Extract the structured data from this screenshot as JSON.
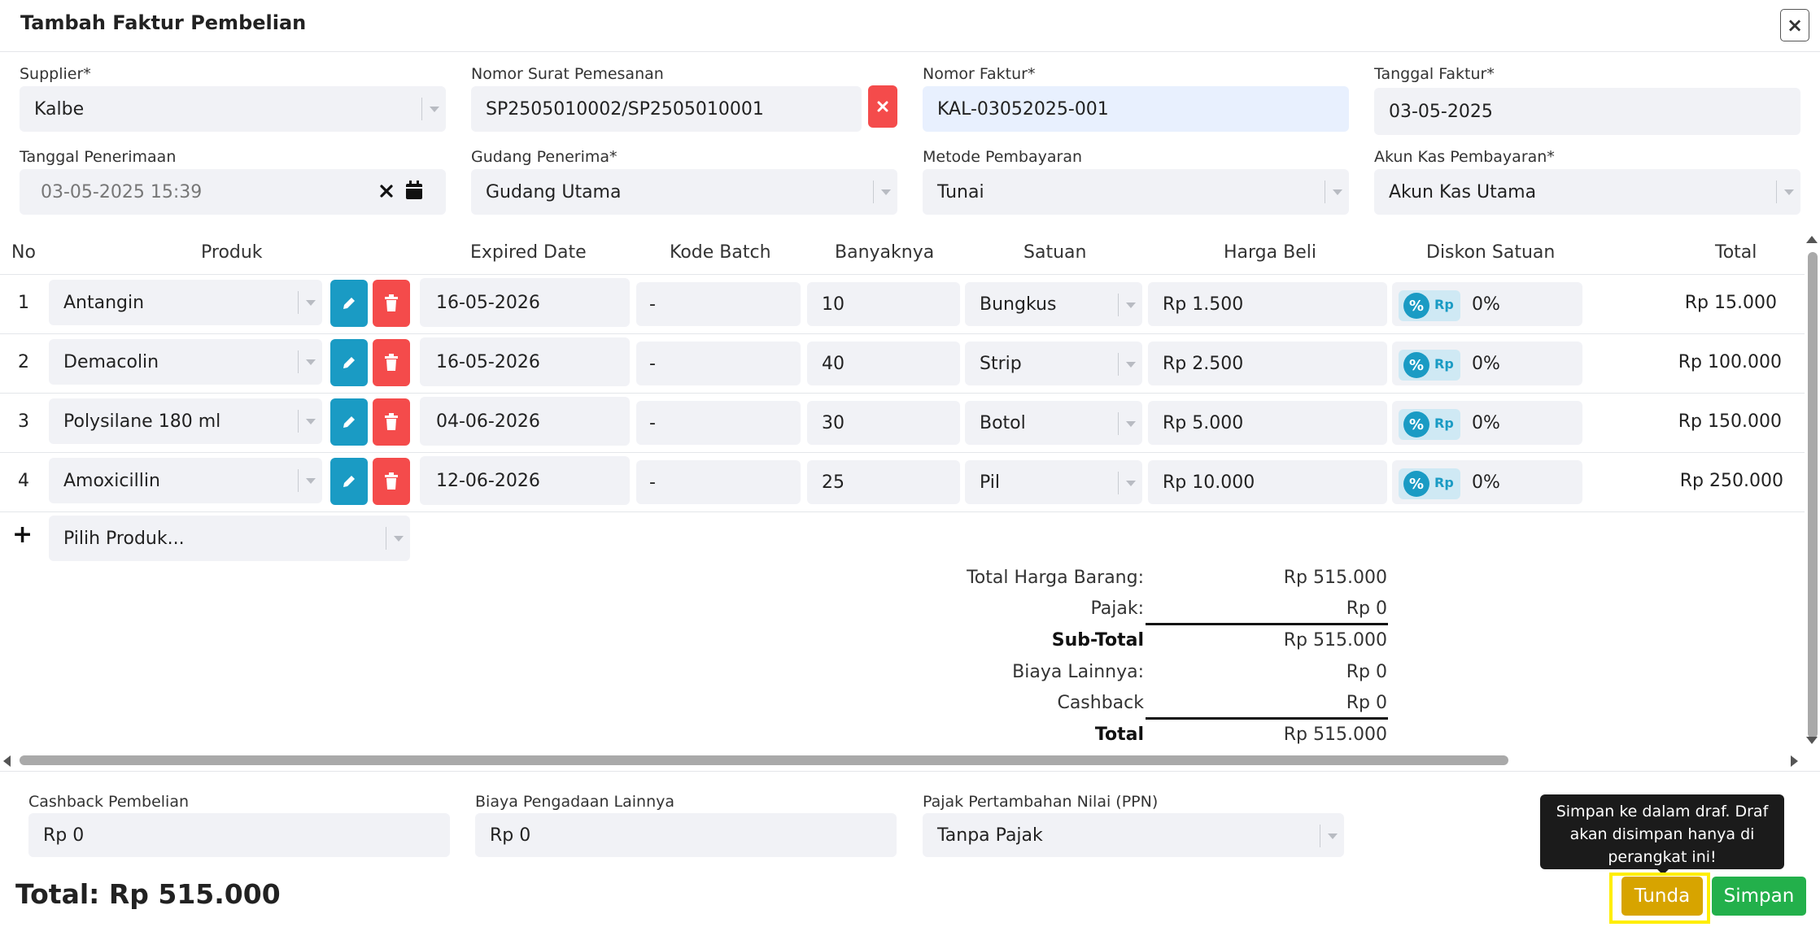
{
  "header": {
    "title": "Tambah Faktur Pembelian",
    "close_label": "×"
  },
  "form": {
    "supplier": {
      "label": "Supplier*",
      "value": "Kalbe"
    },
    "nomor_sp": {
      "label": "Nomor Surat Pemesanan",
      "value": "SP2505010002/SP2505010001"
    },
    "nomor_faktur": {
      "label": "Nomor Faktur*",
      "value": "KAL-03052025-001"
    },
    "tanggal_faktur": {
      "label": "Tanggal Faktur*",
      "value": "03-05-2025"
    },
    "tanggal_penerimaan": {
      "label": "Tanggal Penerimaan",
      "value": "03-05-2025 15:39"
    },
    "gudang": {
      "label": "Gudang Penerima*",
      "value": "Gudang Utama"
    },
    "metode": {
      "label": "Metode Pembayaran",
      "value": "Tunai"
    },
    "akun_kas": {
      "label": "Akun Kas Pembayaran*",
      "value": "Akun Kas Utama"
    }
  },
  "table": {
    "headers": {
      "no": "No",
      "produk": "Produk",
      "expired": "Expired Date",
      "batch": "Kode Batch",
      "qty": "Banyaknya",
      "satuan": "Satuan",
      "harga": "Harga Beli",
      "diskon": "Diskon Satuan",
      "total": "Total"
    },
    "rows": [
      {
        "no": "1",
        "produk": "Antangin",
        "expired": "16-05-2026",
        "batch": "-",
        "qty": "10",
        "satuan": "Bungkus",
        "harga": "Rp 1.500",
        "diskon": "0%",
        "total": "Rp 15.000"
      },
      {
        "no": "2",
        "produk": "Demacolin",
        "expired": "16-05-2026",
        "batch": "-",
        "qty": "40",
        "satuan": "Strip",
        "harga": "Rp 2.500",
        "diskon": "0%",
        "total": "Rp 100.000"
      },
      {
        "no": "3",
        "produk": "Polysilane 180 ml",
        "expired": "04-06-2026",
        "batch": "-",
        "qty": "30",
        "satuan": "Botol",
        "harga": "Rp 5.000",
        "diskon": "0%",
        "total": "Rp 150.000"
      },
      {
        "no": "4",
        "produk": "Amoxicillin",
        "expired": "12-06-2026",
        "batch": "-",
        "qty": "25",
        "satuan": "Pil",
        "harga": "Rp 10.000",
        "diskon": "0%",
        "total": "Rp 250.000"
      }
    ],
    "add_symbol": "+",
    "add_placeholder": "Pilih Produk...",
    "discount_pct_symbol": "%",
    "discount_rp_symbol": "Rp"
  },
  "summary": {
    "total_harga": {
      "label": "Total Harga Barang:",
      "value": "Rp 515.000"
    },
    "pajak": {
      "label": "Pajak:",
      "value": "Rp 0"
    },
    "sub_total": {
      "label": "Sub-Total",
      "value": "Rp 515.000"
    },
    "biaya_lainnya": {
      "label": "Biaya Lainnya:",
      "value": "Rp 0"
    },
    "cashback": {
      "label": "Cashback",
      "value": "Rp 0"
    },
    "total": {
      "label": "Total",
      "value": "Rp 515.000"
    }
  },
  "footer": {
    "cashback_pembelian": {
      "label": "Cashback Pembelian",
      "value": "Rp 0"
    },
    "biaya_pengadaan": {
      "label": "Biaya Pengadaan Lainnya",
      "value": "Rp 0"
    },
    "ppn": {
      "label": "Pajak Pertambahan Nilai (PPN)",
      "value": "Tanpa Pajak"
    },
    "grand_total": "Total: Rp 515.000",
    "tooltip": "Simpan ke dalam draf. Draf akan disimpan hanya di perangkat ini!",
    "tunda_label": "Tunda",
    "simpan_label": "Simpan"
  },
  "colors": {
    "accent_blue": "#1a9bc4",
    "danger": "#f44b4b",
    "success": "#23b04b",
    "warning": "#d7a400",
    "highlight": "#ffee00"
  }
}
